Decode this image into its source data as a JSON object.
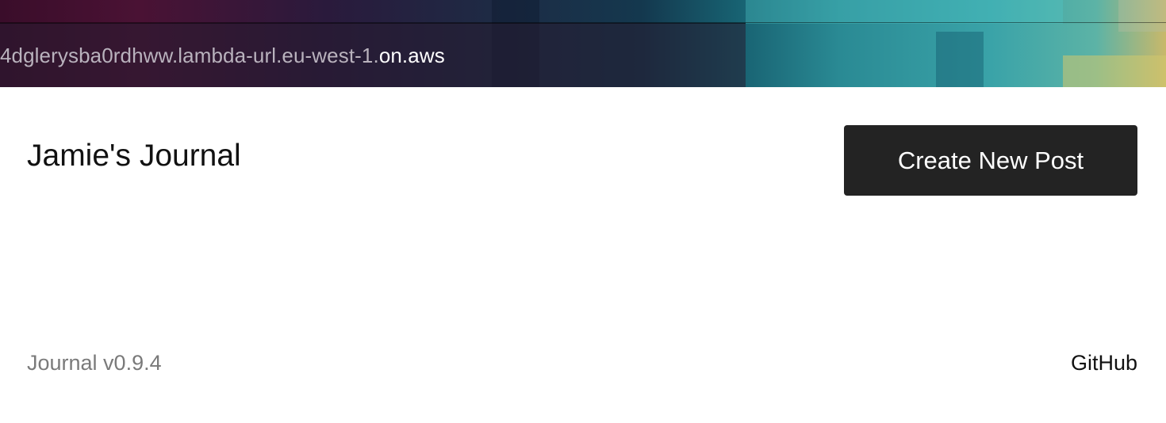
{
  "browser": {
    "url_dim": "4dglerysba0rdhww.lambda-url.eu-west-1.",
    "url_bright": "on.aws"
  },
  "header": {
    "title": "Jamie's Journal",
    "create_button_label": "Create New Post"
  },
  "footer": {
    "version_text": "Journal v0.9.4",
    "github_label": "GitHub"
  },
  "colors": {
    "button_bg": "#232323",
    "button_text": "#ffffff",
    "muted_text": "#7a7a7a"
  }
}
